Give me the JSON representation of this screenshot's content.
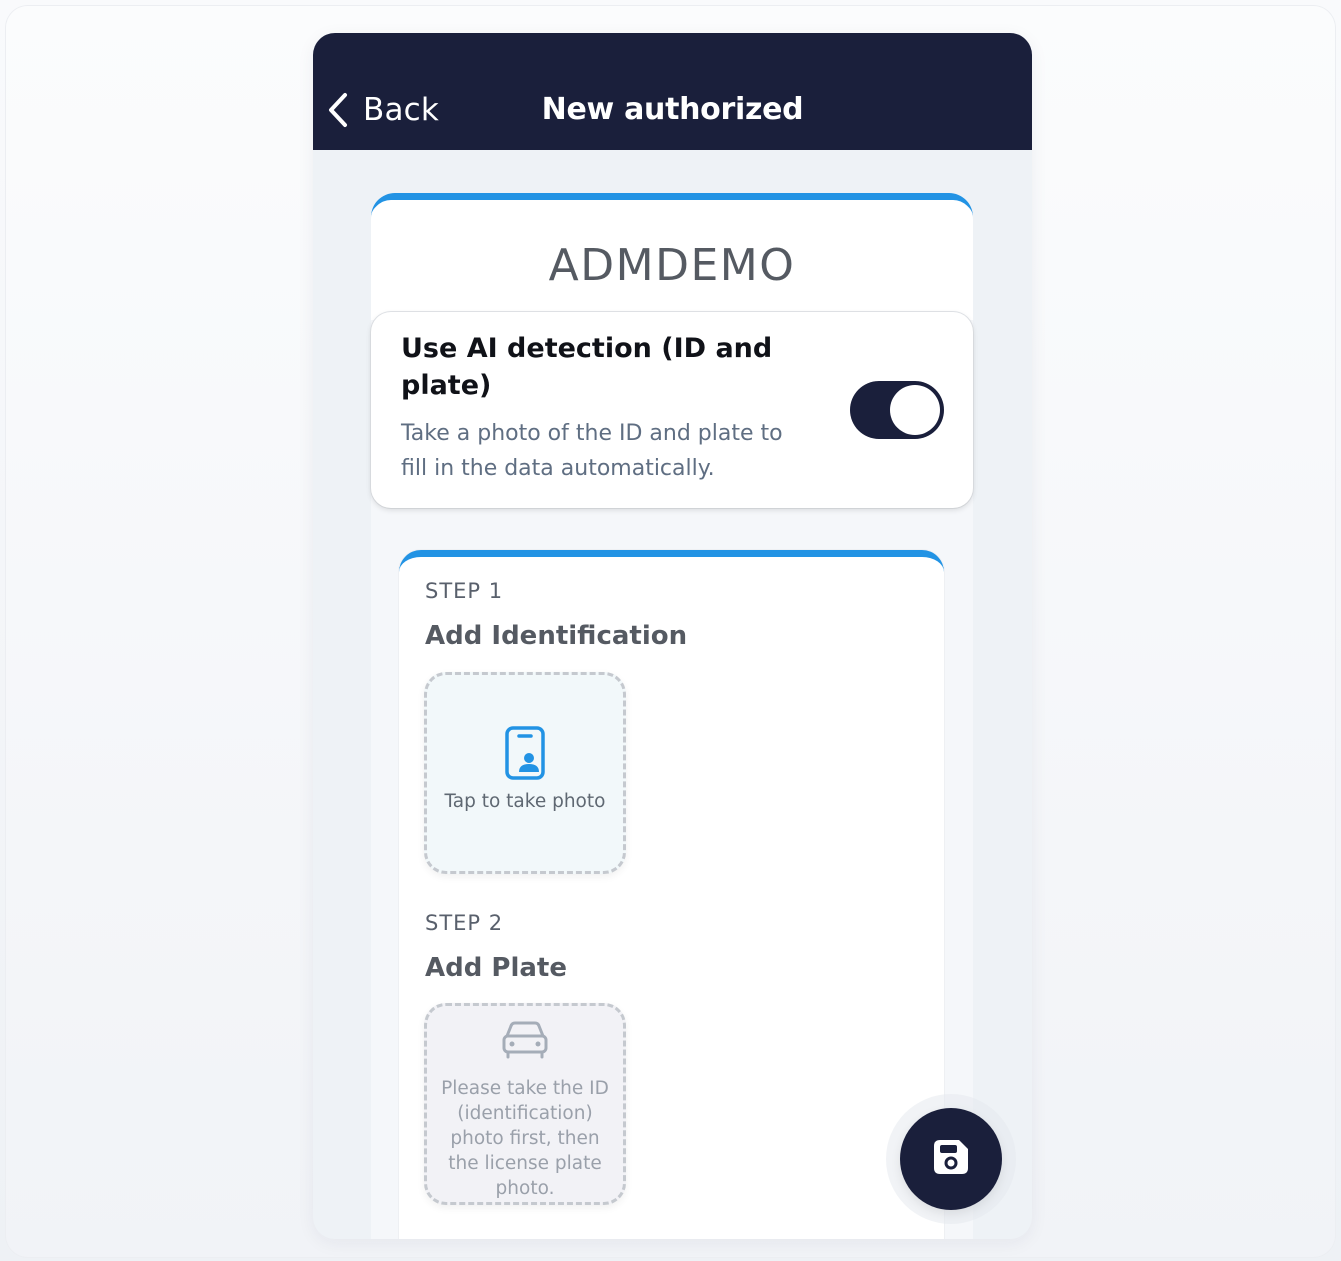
{
  "header": {
    "back_label": "Back",
    "title": "New authorized"
  },
  "company": {
    "name": "ADMDEMO"
  },
  "ai_detection": {
    "title": "Use AI detection (ID and plate)",
    "description": "Take a photo of the ID and plate to fill in the data automatically.",
    "enabled": true
  },
  "steps": [
    {
      "label": "STEP 1",
      "title": "Add Identification",
      "icon": "id-card-icon",
      "hint": "Tap to take photo"
    },
    {
      "label": "STEP 2",
      "title": "Add Plate",
      "icon": "car-icon",
      "hint": "Please take the ID (identification) photo first, then the license plate photo."
    }
  ],
  "fab": {
    "icon": "save-icon"
  },
  "colors": {
    "header_bg": "#1a1f3b",
    "accent_blue": "#2293e4",
    "toggle_on": "#1a1f3b"
  }
}
